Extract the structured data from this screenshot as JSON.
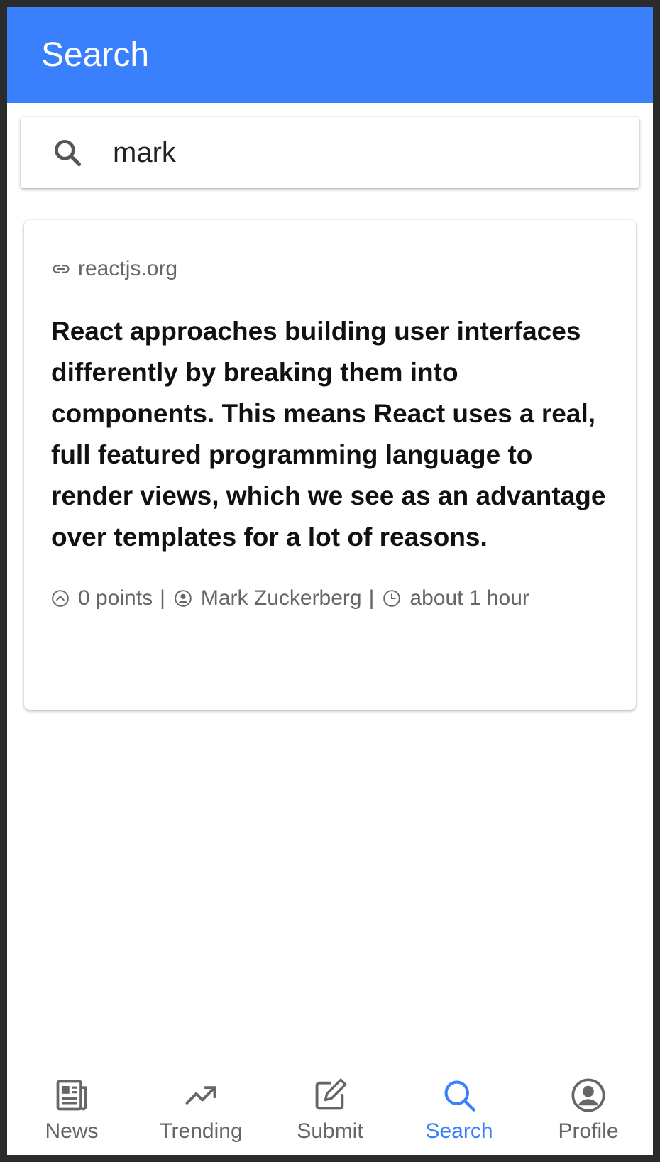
{
  "header": {
    "title": "Search"
  },
  "search": {
    "value": "mark",
    "icon": "search-icon"
  },
  "result": {
    "source": "reactjs.org",
    "title": "React approaches building user interfaces differently by breaking them into components. This means React uses a real, full featured programming language to render views, which we see as an advantage over templates for a lot of reasons.",
    "points": "0 points",
    "author": "Mark Zuckerberg",
    "time": "about 1 hour",
    "separator": "|"
  },
  "nav": {
    "items": [
      {
        "label": "News",
        "icon": "news-icon"
      },
      {
        "label": "Trending",
        "icon": "trending-icon"
      },
      {
        "label": "Submit",
        "icon": "submit-icon"
      },
      {
        "label": "Search",
        "icon": "search-icon"
      },
      {
        "label": "Profile",
        "icon": "profile-icon"
      }
    ],
    "active": "Search"
  },
  "colors": {
    "primary": "#3a80fc",
    "muted": "#666666",
    "text": "#111111"
  }
}
